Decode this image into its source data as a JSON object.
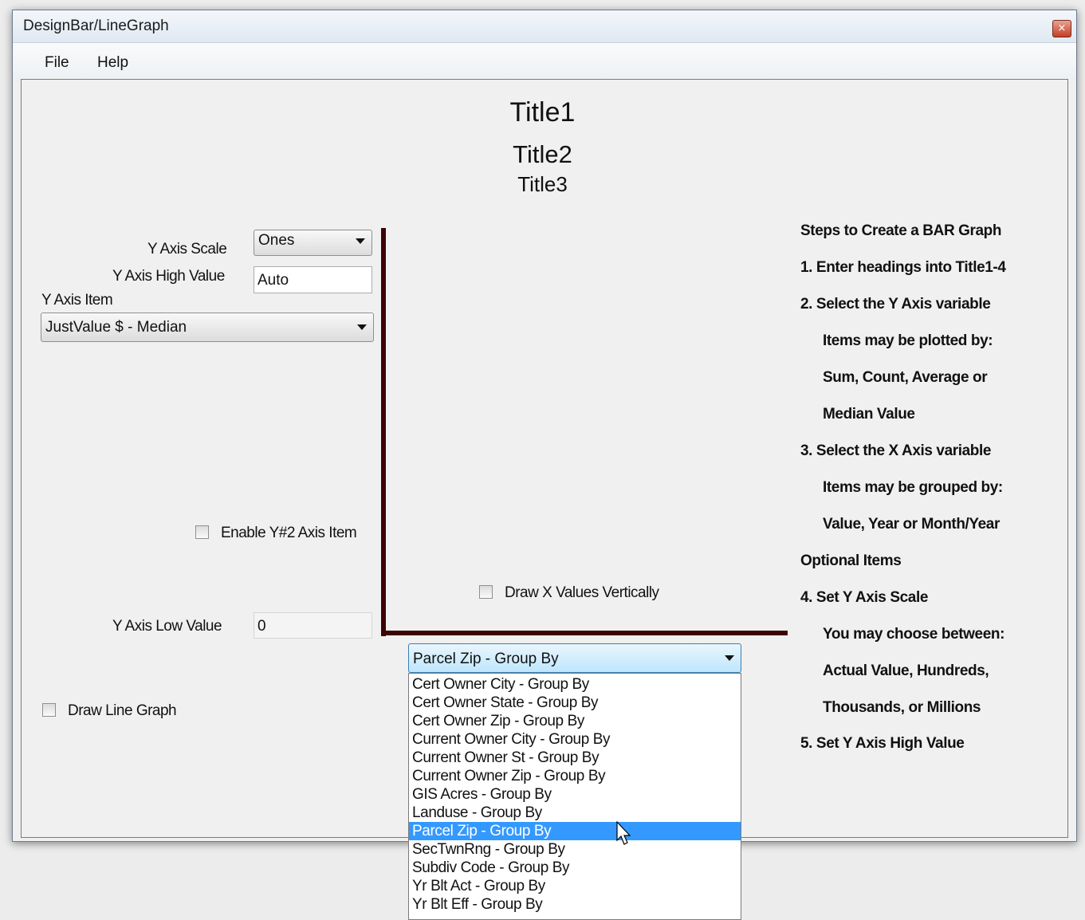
{
  "window": {
    "title": "DesignBar/LineGraph",
    "close_glyph": "×"
  },
  "menu": [
    {
      "label": "File"
    },
    {
      "label": "Help"
    }
  ],
  "titles": {
    "title1": "Title1",
    "title2": "Title2",
    "title3": "Title3"
  },
  "y_axis": {
    "scale_label": "Y Axis Scale",
    "scale_value": "Ones",
    "high_label": "Y Axis High Value",
    "high_value": "Auto",
    "item_label": "Y Axis Item",
    "item_value": "JustValue $ - Median",
    "enable_y2_label": "Enable Y#2 Axis Item",
    "low_label": "Y Axis Low Value",
    "low_value": "0",
    "draw_line_label": "Draw Line Graph"
  },
  "x_axis": {
    "draw_vertical_label": "Draw X Values Vertically",
    "selected": "Parcel Zip - Group By",
    "options": [
      "Cert Owner City - Group By",
      "Cert Owner State - Group By",
      "Cert Owner Zip - Group By",
      "Current Owner City - Group By",
      "Current Owner St - Group By",
      "Current Owner Zip - Group By",
      "GIS Acres - Group By",
      "Landuse - Group By",
      "Parcel Zip - Group By",
      "SecTwnRng - Group By",
      "Subdiv Code - Group By",
      "Yr Blt Act - Group By",
      "Yr Blt Eff - Group By"
    ],
    "highlighted_index": 8
  },
  "steps": [
    "Steps to Create a BAR Graph",
    "1.  Enter headings into Title1-4",
    "2.  Select the Y Axis variable",
    "Items may be plotted by:",
    "Sum, Count, Average or",
    "Median Value",
    "3.  Select the X Axis variable",
    "Items may be grouped by:",
    "Value, Year or Month/Year",
    "Optional Items",
    "4.  Set Y Axis Scale",
    "You may choose between:",
    "Actual Value, Hundreds,",
    "Thousands, or Millions",
    "5.  Set Y Axis High Value"
  ],
  "colors": {
    "axis": "#3c0404",
    "selection": "#3399ff"
  }
}
